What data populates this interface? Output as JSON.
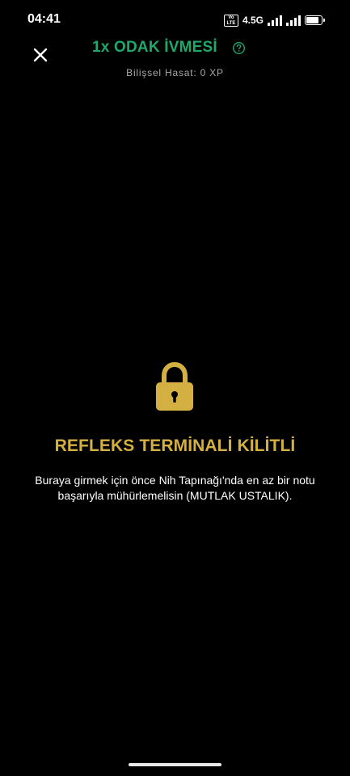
{
  "status_bar": {
    "time": "04:41",
    "volte_badge": "Vo LTE",
    "network": "4.5G",
    "icons": [
      "volte-icon",
      "signal-icon",
      "signal-icon",
      "battery-icon"
    ]
  },
  "header": {
    "title": "1x ODAK İVMESİ",
    "subtitle": "Bilişsel Hasat: 0 XP",
    "close_icon": "close-icon",
    "help_icon": "help-icon"
  },
  "locked": {
    "icon": "lock-icon",
    "title": "REFLEKS TERMİNALİ KİLİTLİ",
    "description": "Buraya girmek için önce Nih Tapınağı'nda en az bir notu başarıyla mühürlemelisin (MUTLAK USTALIK)."
  },
  "colors": {
    "background": "#000000",
    "title_green": "#1fa86a",
    "lock_gold": "#d3b041",
    "subtitle_gray": "#a8a8a8"
  }
}
